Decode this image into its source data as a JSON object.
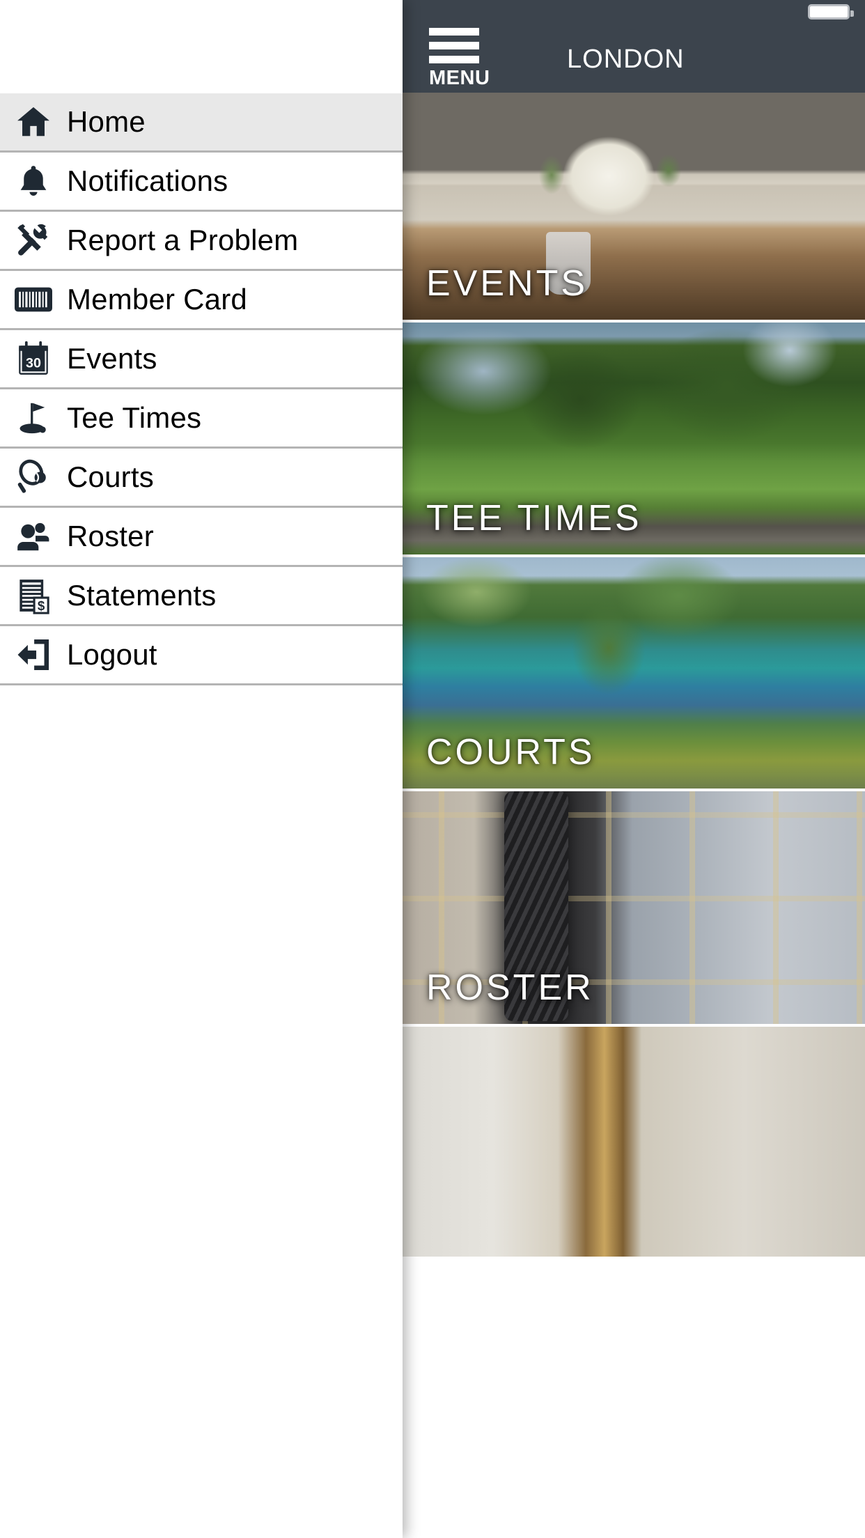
{
  "status_bar": {
    "battery_icon": "battery-full-icon"
  },
  "header": {
    "menu_label": "MENU",
    "hamburger_icon": "hamburger-menu-icon",
    "club_title": "LONDON",
    "background_color": "#3c444d"
  },
  "drawer": {
    "items": [
      {
        "label": "Home",
        "icon": "home-icon",
        "active": true
      },
      {
        "label": "Notifications",
        "icon": "bell-icon",
        "active": false
      },
      {
        "label": "Report a Problem",
        "icon": "tools-icon",
        "active": false
      },
      {
        "label": "Member Card",
        "icon": "barcode-icon",
        "active": false
      },
      {
        "label": "Events",
        "icon": "calendar-icon",
        "active": false
      },
      {
        "label": "Tee Times",
        "icon": "golf-flag-icon",
        "active": false
      },
      {
        "label": "Courts",
        "icon": "tennis-racket-icon",
        "active": false
      },
      {
        "label": "Roster",
        "icon": "people-icon",
        "active": false
      },
      {
        "label": "Statements",
        "icon": "invoice-icon",
        "active": false
      },
      {
        "label": "Logout",
        "icon": "exit-icon",
        "active": false
      }
    ],
    "calendar_day": "30",
    "active_background": "#e8e8e8",
    "divider_color": "#b4b4b4"
  },
  "tiles": [
    {
      "label": "EVENTS",
      "photo": "dining-room-floral-centerpiece"
    },
    {
      "label": "TEE TIMES",
      "photo": "golf-course-green-trees"
    },
    {
      "label": "COURTS",
      "photo": "tennis-courts-flowers"
    },
    {
      "label": "ROSTER",
      "photo": "golf-bag-plaid-fabric"
    },
    {
      "label": "",
      "photo": "framed-picture-wall"
    }
  ]
}
